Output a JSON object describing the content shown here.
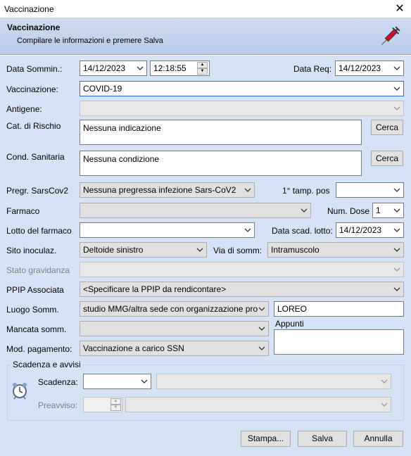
{
  "window": {
    "title": "Vaccinazione",
    "close_glyph": "✕"
  },
  "header": {
    "title": "Vaccinazione",
    "subtitle": "Compilare le informazioni e premere Salva",
    "icon": "syringe-icon"
  },
  "form": {
    "data_sommin": {
      "label": "Data Sommin.:",
      "date": "14/12/2023",
      "time": "12:18:55"
    },
    "data_req": {
      "label": "Data Req:",
      "value": "14/12/2023"
    },
    "vaccinazione": {
      "label": "Vaccinazione:",
      "value": "COVID-19"
    },
    "antigene": {
      "label": "Antigene:",
      "value": ""
    },
    "cat_rischio": {
      "label": "Cat. di Rischio",
      "value": "Nessuna indicazione",
      "button": "Cerca"
    },
    "cond_sanitaria": {
      "label": "Cond. Sanitaria",
      "value": "Nessuna condizione",
      "button": "Cerca"
    },
    "pregr_sarscov2": {
      "label": "Pregr. SarsCov2",
      "value": "Nessuna pregressa infezione Sars-CoV2"
    },
    "tamp_pos": {
      "label": "1° tamp. pos",
      "value": ""
    },
    "farmaco": {
      "label": "Farmaco",
      "value": ""
    },
    "num_dose": {
      "label": "Num. Dose",
      "value": "1"
    },
    "lotto": {
      "label": "Lotto del farmaco",
      "value": ""
    },
    "data_scad_lotto": {
      "label": "Data scad. lotto:",
      "value": "14/12/2023"
    },
    "sito_inoculaz": {
      "label": "Sito inoculaz.",
      "value": "Deltoide sinistro"
    },
    "via_somm": {
      "label": "Via di somm:",
      "value": "Intramuscolo"
    },
    "stato_gravidanza": {
      "label": "Stato gravidanza",
      "value": ""
    },
    "ppip": {
      "label": "PPIP Associata",
      "value": "<Specificare la PPIP da rendicontare>"
    },
    "luogo_somm": {
      "label": "Luogo Somm.",
      "value": "studio MMG/altra sede con organizzazione pro",
      "place": "LOREO"
    },
    "mancata_somm": {
      "label": "Mancata somm.",
      "value": ""
    },
    "appunti": {
      "label": "Appunti",
      "value": ""
    },
    "mod_pagamento": {
      "label": "Mod. pagamento:",
      "value": "Vaccinazione a carico SSN"
    }
  },
  "scadenza": {
    "group_title": "Scadenza e avvisi",
    "icon": "alarm-clock-icon",
    "scadenza_label": "Scadenza:",
    "preavviso_label": "Preavviso:"
  },
  "buttons": {
    "stampa": "Stampa...",
    "salva": "Salva",
    "annulla": "Annulla"
  },
  "colors": {
    "header_bg": "#c5d5ef",
    "body_bg": "#d6e3f7",
    "focus_border": "#2a6fd6"
  }
}
